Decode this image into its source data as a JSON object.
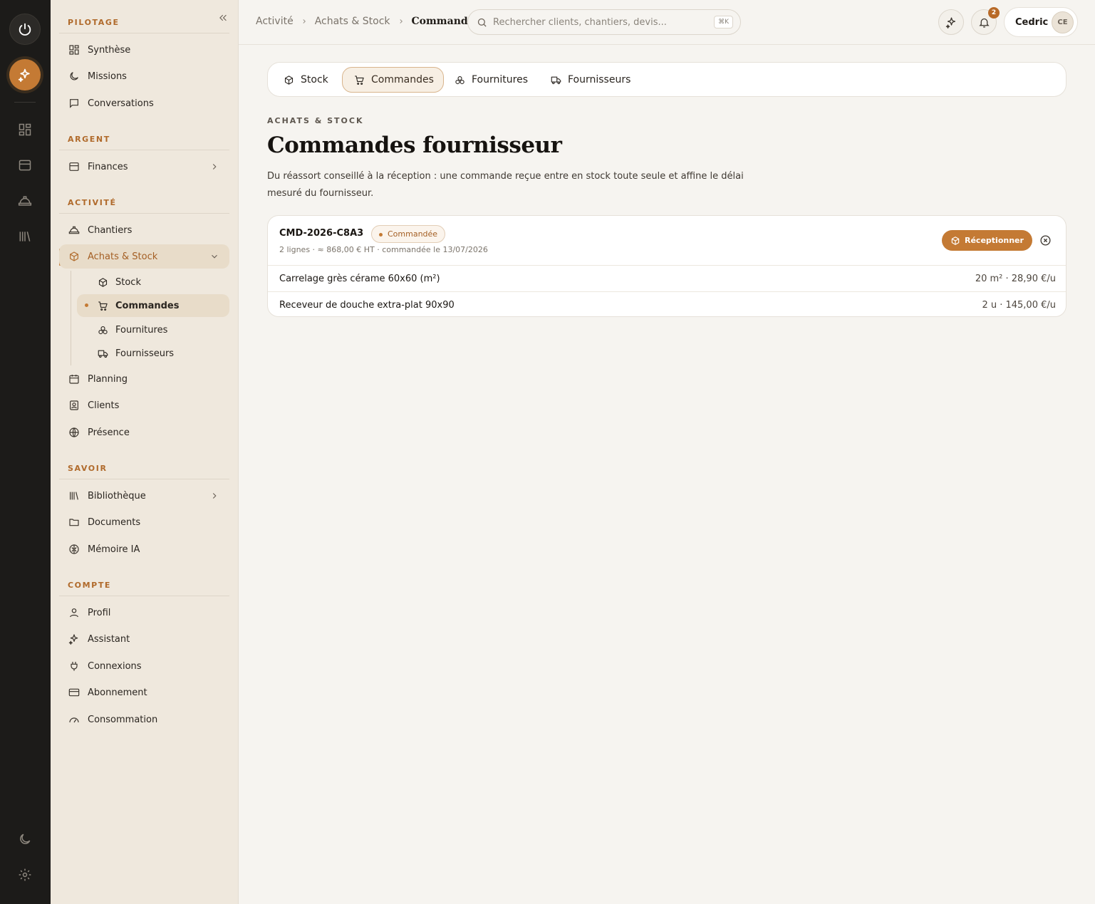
{
  "sidebar": {
    "sections": {
      "pilotage": "PILOTAGE",
      "argent": "ARGENT",
      "activite": "ACTIVITÉ",
      "savoir": "SAVOIR",
      "compte": "COMPTE"
    },
    "items": {
      "synthese": "Synthèse",
      "missions": "Missions",
      "conversations": "Conversations",
      "finances": "Finances",
      "chantiers": "Chantiers",
      "achats_stock": "Achats & Stock",
      "stock": "Stock",
      "commandes": "Commandes",
      "fournitures": "Fournitures",
      "fournisseurs": "Fournisseurs",
      "planning": "Planning",
      "clients": "Clients",
      "presence": "Présence",
      "bibliotheque": "Bibliothèque",
      "documents": "Documents",
      "memoire_ia": "Mémoire IA",
      "profil": "Profil",
      "assistant": "Assistant",
      "connexions": "Connexions",
      "abonnement": "Abonnement",
      "consommation": "Consommation"
    }
  },
  "topbar": {
    "breadcrumb": [
      "Activité",
      "Achats & Stock",
      "Commandes"
    ],
    "search_placeholder": "Rechercher clients, chantiers, devis...",
    "search_shortcut": "⌘K",
    "notification_count": "2",
    "user_name": "Cedric",
    "user_initials": "CE"
  },
  "tabs": [
    "Stock",
    "Commandes",
    "Fournitures",
    "Fournisseurs"
  ],
  "page": {
    "eyebrow": "ACHATS & STOCK",
    "title": "Commandes fournisseur",
    "description": "Du réassort conseillé à la réception : une commande reçue entre en stock toute seule et affine le délai mesuré du fournisseur."
  },
  "order": {
    "reference": "CMD-2026-C8A3",
    "status": "Commandée",
    "meta": "2 lignes · ≈ 868,00 € HT · commandée le 13/07/2026",
    "receive_label": "Réceptionner",
    "lines": [
      {
        "name": "Carrelage grès cérame 60x60 (m²)",
        "value": "20 m² · 28,90 €/u"
      },
      {
        "name": "Receveur de douche extra-plat 90x90",
        "value": "2 u · 145,00 €/u"
      }
    ]
  },
  "colors": {
    "accent": "#c47a34",
    "rail": "#1c1b19",
    "sidebar": "#efe8dd",
    "background": "#f6f4f0"
  }
}
